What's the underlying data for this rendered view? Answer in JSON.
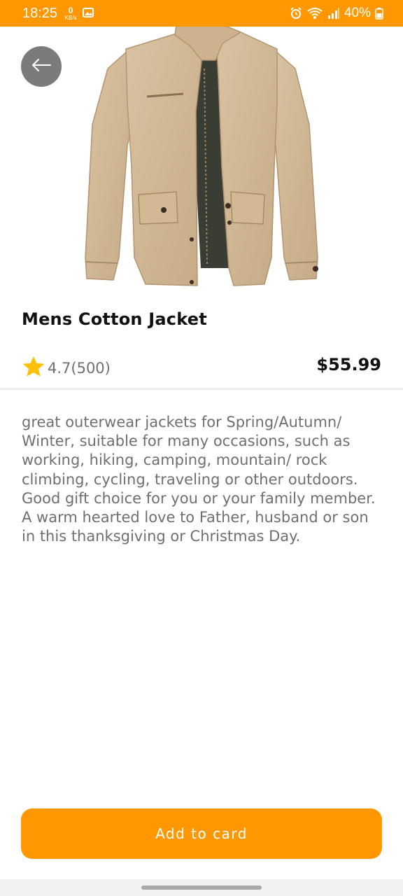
{
  "status_bar": {
    "time": "18:25",
    "net_speed_value": "0",
    "net_speed_unit": "KB/s",
    "battery": "40%",
    "background_color": "#FF9800",
    "icons": [
      "gallery-icon",
      "alarm-icon",
      "wifi-icon",
      "signal-icon",
      "battery-icon"
    ]
  },
  "product": {
    "image_icon": "jacket-image",
    "title": "Mens Cotton Jacket",
    "rating": "4.7(500)",
    "price": "$55.99",
    "description": "great outerwear jackets for Spring/Autumn/ Winter, suitable for many occasions, such as working, hiking, camping, mountain/ rock climbing, cycling, traveling or other outdoors. Good gift choice for you or your family member. A warm hearted love to Father, husband or son in this thanksgiving or Christmas Day."
  },
  "actions": {
    "back_icon": "arrow-left-icon",
    "add_label": "Add to card"
  },
  "colors": {
    "accent": "#FF9800",
    "star": "#FFC107",
    "text_primary": "#111111",
    "text_secondary": "#6f6f6f",
    "back_button_bg": "#7b7b7b"
  }
}
